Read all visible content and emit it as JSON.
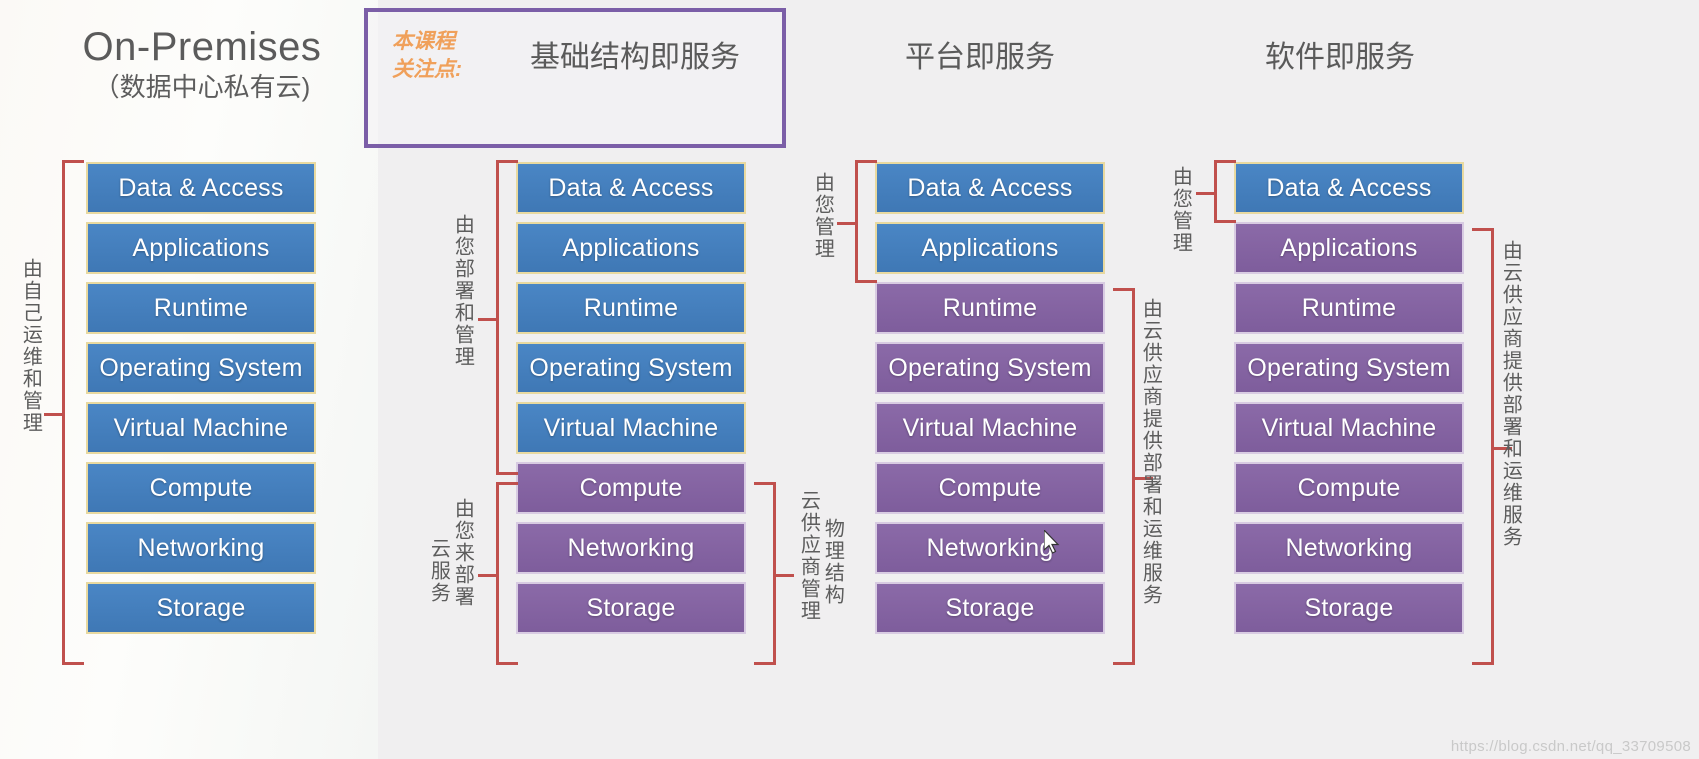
{
  "columns": [
    {
      "key": "on_premises",
      "title_en": "On-Premises",
      "title_cn": "（数据中心私有云)",
      "layers": [
        {
          "label": "Data & Access",
          "tone": "blue"
        },
        {
          "label": "Applications",
          "tone": "blue"
        },
        {
          "label": "Runtime",
          "tone": "blue"
        },
        {
          "label": "Operating System",
          "tone": "blue"
        },
        {
          "label": "Virtual Machine",
          "tone": "blue"
        },
        {
          "label": "Compute",
          "tone": "blue"
        },
        {
          "label": "Networking",
          "tone": "blue"
        },
        {
          "label": "Storage",
          "tone": "blue"
        }
      ],
      "brackets": [
        {
          "side": "left",
          "label": "由自己运维和管理",
          "covers": "all"
        }
      ]
    },
    {
      "key": "iaas",
      "title_cn": "基础结构即服务",
      "focus_note": "本课程\n关注点:",
      "layers": [
        {
          "label": "Data & Access",
          "tone": "blue"
        },
        {
          "label": "Applications",
          "tone": "blue"
        },
        {
          "label": "Runtime",
          "tone": "blue"
        },
        {
          "label": "Operating System",
          "tone": "blue"
        },
        {
          "label": "Virtual Machine",
          "tone": "blue"
        },
        {
          "label": "Compute",
          "tone": "purple"
        },
        {
          "label": "Networking",
          "tone": "purple"
        },
        {
          "label": "Storage",
          "tone": "purple"
        }
      ],
      "brackets": [
        {
          "side": "left",
          "label": "由您部署和管理",
          "covers": "1-5"
        },
        {
          "side": "left",
          "label": "由您来部署\n云服务",
          "covers": "6-8"
        },
        {
          "side": "right",
          "label": "云供应商管理\n物理结构",
          "covers": "6-8"
        }
      ]
    },
    {
      "key": "paas",
      "title_cn": "平台即服务",
      "layers": [
        {
          "label": "Data & Access",
          "tone": "blue"
        },
        {
          "label": "Applications",
          "tone": "blue"
        },
        {
          "label": "Runtime",
          "tone": "purple"
        },
        {
          "label": "Operating System",
          "tone": "purple"
        },
        {
          "label": "Virtual Machine",
          "tone": "purple"
        },
        {
          "label": "Compute",
          "tone": "purple"
        },
        {
          "label": "Networking",
          "tone": "purple"
        },
        {
          "label": "Storage",
          "tone": "purple"
        }
      ],
      "brackets": [
        {
          "side": "left",
          "label": "由您管理",
          "covers": "1-2"
        },
        {
          "side": "right",
          "label": "由云供应商提供部署和运维服务",
          "covers": "3-8"
        }
      ]
    },
    {
      "key": "saas",
      "title_cn": "软件即服务",
      "layers": [
        {
          "label": "Data & Access",
          "tone": "blue"
        },
        {
          "label": "Applications",
          "tone": "purple"
        },
        {
          "label": "Runtime",
          "tone": "purple"
        },
        {
          "label": "Operating System",
          "tone": "purple"
        },
        {
          "label": "Virtual Machine",
          "tone": "purple"
        },
        {
          "label": "Compute",
          "tone": "purple"
        },
        {
          "label": "Networking",
          "tone": "purple"
        },
        {
          "label": "Storage",
          "tone": "purple"
        }
      ],
      "brackets": [
        {
          "side": "left",
          "label": "由您管理",
          "covers": "1"
        },
        {
          "side": "right",
          "label": "由云供应商提供部署和运维服务",
          "covers": "2-8"
        }
      ]
    }
  ],
  "labels": {
    "col1_left": "由自己运维和管理",
    "col2_left_top": "由您部署和管理",
    "col2_left_bottom_l1": "由您来部署",
    "col2_left_bottom_l2": "云服务",
    "col2_right_l1": "云供应商管理",
    "col2_right_l2": "物理结构",
    "col3_left": "由您管理",
    "col3_right": "由云供应商提供部署和运维服务",
    "col4_left": "由您管理",
    "col4_right": "由云供应商提供部署和运维服务"
  },
  "watermark": "https://blog.csdn.net/qq_33709508",
  "theme": {
    "blue_fill": "#4280bd",
    "blue_border": "#e8d9a0",
    "purple_fill": "#8263a2",
    "purple_border": "#d8cbe2",
    "bracket_red": "#c0504d",
    "focus_border": "#7b5ea7",
    "focus_note_color": "#f0a05a",
    "text_gray": "#5d5d5d",
    "background": "#f0eff0"
  }
}
